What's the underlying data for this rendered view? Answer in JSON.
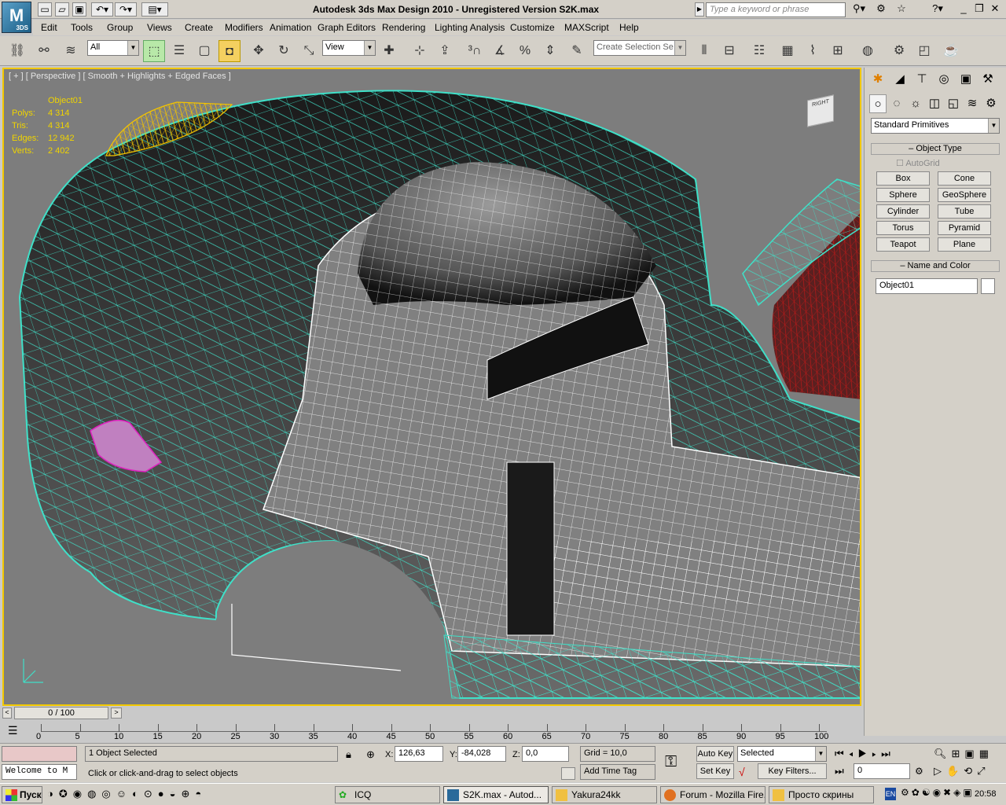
{
  "window": {
    "title": "Autodesk 3ds Max Design 2010  - Unregistered Version    S2K.max",
    "logo_text": "M",
    "logo_sub": "3DS"
  },
  "search": {
    "placeholder": "Type a keyword or phrase"
  },
  "menu": [
    "Edit",
    "Tools",
    "Group",
    "Views",
    "Create",
    "Modifiers",
    "Animation",
    "Graph Editors",
    "Rendering",
    "Lighting Analysis",
    "Customize",
    "MAXScript",
    "Help"
  ],
  "toolbar": {
    "filter_value": "All",
    "refcoord_value": "View",
    "selset_placeholder": "Create Selection Se"
  },
  "viewport": {
    "label": "[ + ] [ Perspective ] [ Smooth + Highlights + Edged Faces ]",
    "object_name": "Object01",
    "stats": [
      {
        "k": "Polys:",
        "v": "4 314"
      },
      {
        "k": "Tris:",
        "v": "4 314"
      },
      {
        "k": "Edges:",
        "v": "12 942"
      },
      {
        "k": "Verts:",
        "v": "2 402"
      }
    ],
    "viewcube": "RIGHT",
    "colors": {
      "wire": "#3fe0c8",
      "selected": "#f4c400",
      "magenta": "#e020c0",
      "red": "#c01818"
    }
  },
  "command_panel": {
    "category": "Standard Primitives",
    "object_type": "Object Type",
    "autogrid": "AutoGrid",
    "primitives": [
      "Box",
      "Cone",
      "Sphere",
      "GeoSphere",
      "Cylinder",
      "Tube",
      "Torus",
      "Pyramid",
      "Teapot",
      "Plane"
    ],
    "name_color": "Name and Color",
    "name_value": "Object01"
  },
  "timeline": {
    "frame": "0 / 100",
    "ticks": [
      "0",
      "5",
      "10",
      "15",
      "20",
      "25",
      "30",
      "35",
      "40",
      "45",
      "50",
      "55",
      "60",
      "65",
      "70",
      "75",
      "80",
      "85",
      "90",
      "95",
      "100"
    ]
  },
  "status": {
    "selected": "1 Object Selected",
    "prompt": "Click or click-and-drag to select objects",
    "maxscript": "Welcome to M",
    "x_label": "X:",
    "x": "126,63",
    "y_label": "Y:",
    "y": "-84,028",
    "z_label": "Z:",
    "z": "0,0",
    "grid": "Grid = 10,0",
    "add_time_tag": "Add Time Tag",
    "auto_key": "Auto Key",
    "set_key": "Set Key",
    "key_mode": "Selected",
    "key_filters": "Key Filters...",
    "frame_value": "0"
  },
  "taskbar": {
    "start": "Пуск",
    "tasks": [
      "ICQ",
      "S2K.max - Autod...",
      "Yakura24kk",
      "Forum - Mozilla Fire...",
      "Просто скрины"
    ],
    "lang": "EN",
    "clock": "20:58"
  }
}
